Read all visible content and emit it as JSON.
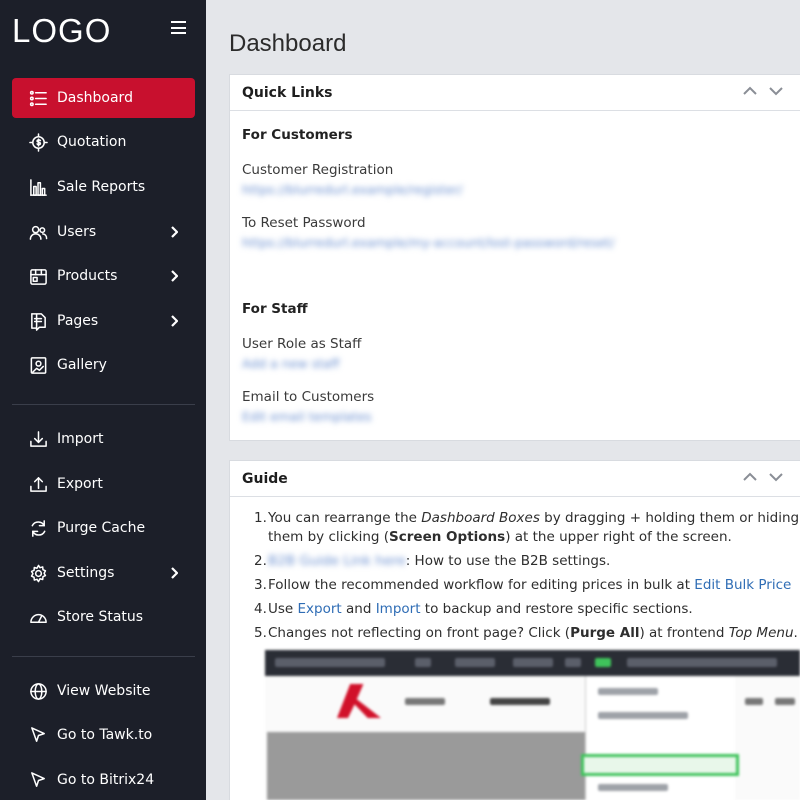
{
  "brand": {
    "logo_text": "LOGO"
  },
  "sidebar": {
    "items": [
      {
        "label": "Dashboard",
        "icon": "list-icon",
        "active": true,
        "has_submenu": false
      },
      {
        "label": "Quotation",
        "icon": "dollar-target-icon",
        "active": false,
        "has_submenu": false
      },
      {
        "label": "Sale Reports",
        "icon": "bar-chart-icon",
        "active": false,
        "has_submenu": false
      },
      {
        "label": "Users",
        "icon": "users-icon",
        "active": false,
        "has_submenu": true
      },
      {
        "label": "Products",
        "icon": "store-icon",
        "active": false,
        "has_submenu": true
      },
      {
        "label": "Pages",
        "icon": "pages-icon",
        "active": false,
        "has_submenu": true
      },
      {
        "label": "Gallery",
        "icon": "gallery-icon",
        "active": false,
        "has_submenu": false
      }
    ],
    "tools": [
      {
        "label": "Import",
        "icon": "download-icon",
        "has_submenu": false
      },
      {
        "label": "Export",
        "icon": "upload-icon",
        "has_submenu": false
      },
      {
        "label": "Purge Cache",
        "icon": "refresh-icon",
        "has_submenu": false
      },
      {
        "label": "Settings",
        "icon": "gear-icon",
        "has_submenu": true
      },
      {
        "label": "Store Status",
        "icon": "gauge-icon",
        "has_submenu": false
      }
    ],
    "external": [
      {
        "label": "View Website",
        "icon": "globe-icon"
      },
      {
        "label": "Go to Tawk.to",
        "icon": "cursor-icon"
      },
      {
        "label": "Go to Bitrix24",
        "icon": "cursor-icon"
      }
    ]
  },
  "page": {
    "title": "Dashboard"
  },
  "quick_links": {
    "title": "Quick Links",
    "customers_heading": "For Customers",
    "customer_registration_label": "Customer Registration",
    "reset_password_label": "To Reset Password",
    "staff_heading": "For Staff",
    "staff_role_label": "User Role as Staff",
    "email_customers_label": "Email to Customers"
  },
  "guide": {
    "title": "Guide",
    "item1": {
      "num": "1.",
      "part1": "You can rearrange the ",
      "em1": "Dashboard Boxes",
      "part2": " by dragging + holding them or hiding them by clicking (",
      "strong1": "Screen Options",
      "part3": ") at the upper right of the screen."
    },
    "item2": {
      "num": "2.",
      "text": ": How to use the B2B settings."
    },
    "item3": {
      "num": "3.",
      "text": "Follow the recommended workflow for editing prices in bulk at ",
      "link": "Edit Bulk Price"
    },
    "item4": {
      "num": "4.",
      "part1": "Use ",
      "link1": "Export",
      "part2": " and ",
      "link2": "Import",
      "part3": " to backup and restore specific sections."
    },
    "item5": {
      "num": "5.",
      "part1": "Changes not reflecting on front page? Click (",
      "strong": "Purge All",
      "part2": ") at frontend ",
      "em": "Top Menu",
      "part3": "."
    }
  },
  "colors": {
    "sidebar_bg": "#1c1f29",
    "active_bg": "#c8102e",
    "link": "#2f6db5",
    "highlight": "#3fc35b"
  }
}
